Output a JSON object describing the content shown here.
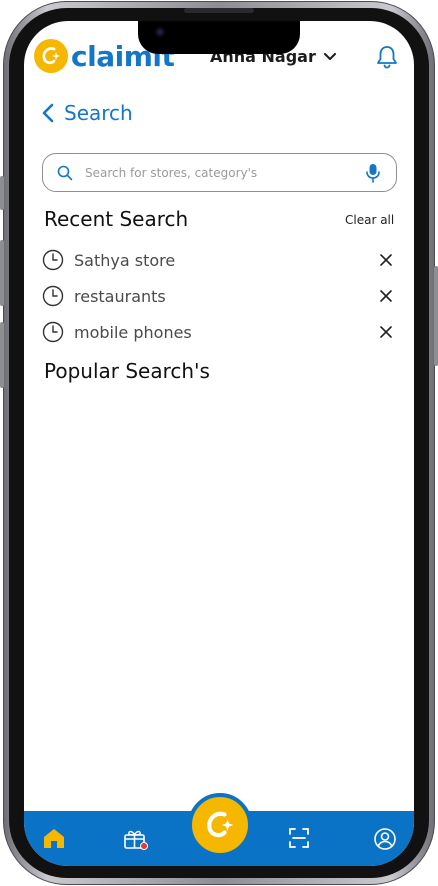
{
  "header": {
    "logo_text": "claimit",
    "location": "Anna Nagar"
  },
  "page": {
    "title": "Search"
  },
  "search": {
    "placeholder": "Search for stores, category's"
  },
  "recent": {
    "title": "Recent Search",
    "clear_label": "Clear all",
    "items": [
      {
        "label": "Sathya store"
      },
      {
        "label": "restaurants"
      },
      {
        "label": "mobile phones"
      }
    ]
  },
  "popular": {
    "title": "Popular Search's"
  },
  "nav": {
    "items": [
      {
        "icon": "home-icon"
      },
      {
        "icon": "gift-icon"
      },
      {
        "icon": "claimit-logo-icon"
      },
      {
        "icon": "scan-icon"
      },
      {
        "icon": "profile-icon"
      }
    ]
  },
  "colors": {
    "brand_blue": "#1476c9",
    "brand_yellow": "#f5b700",
    "nav_blue": "#0b73c6"
  }
}
